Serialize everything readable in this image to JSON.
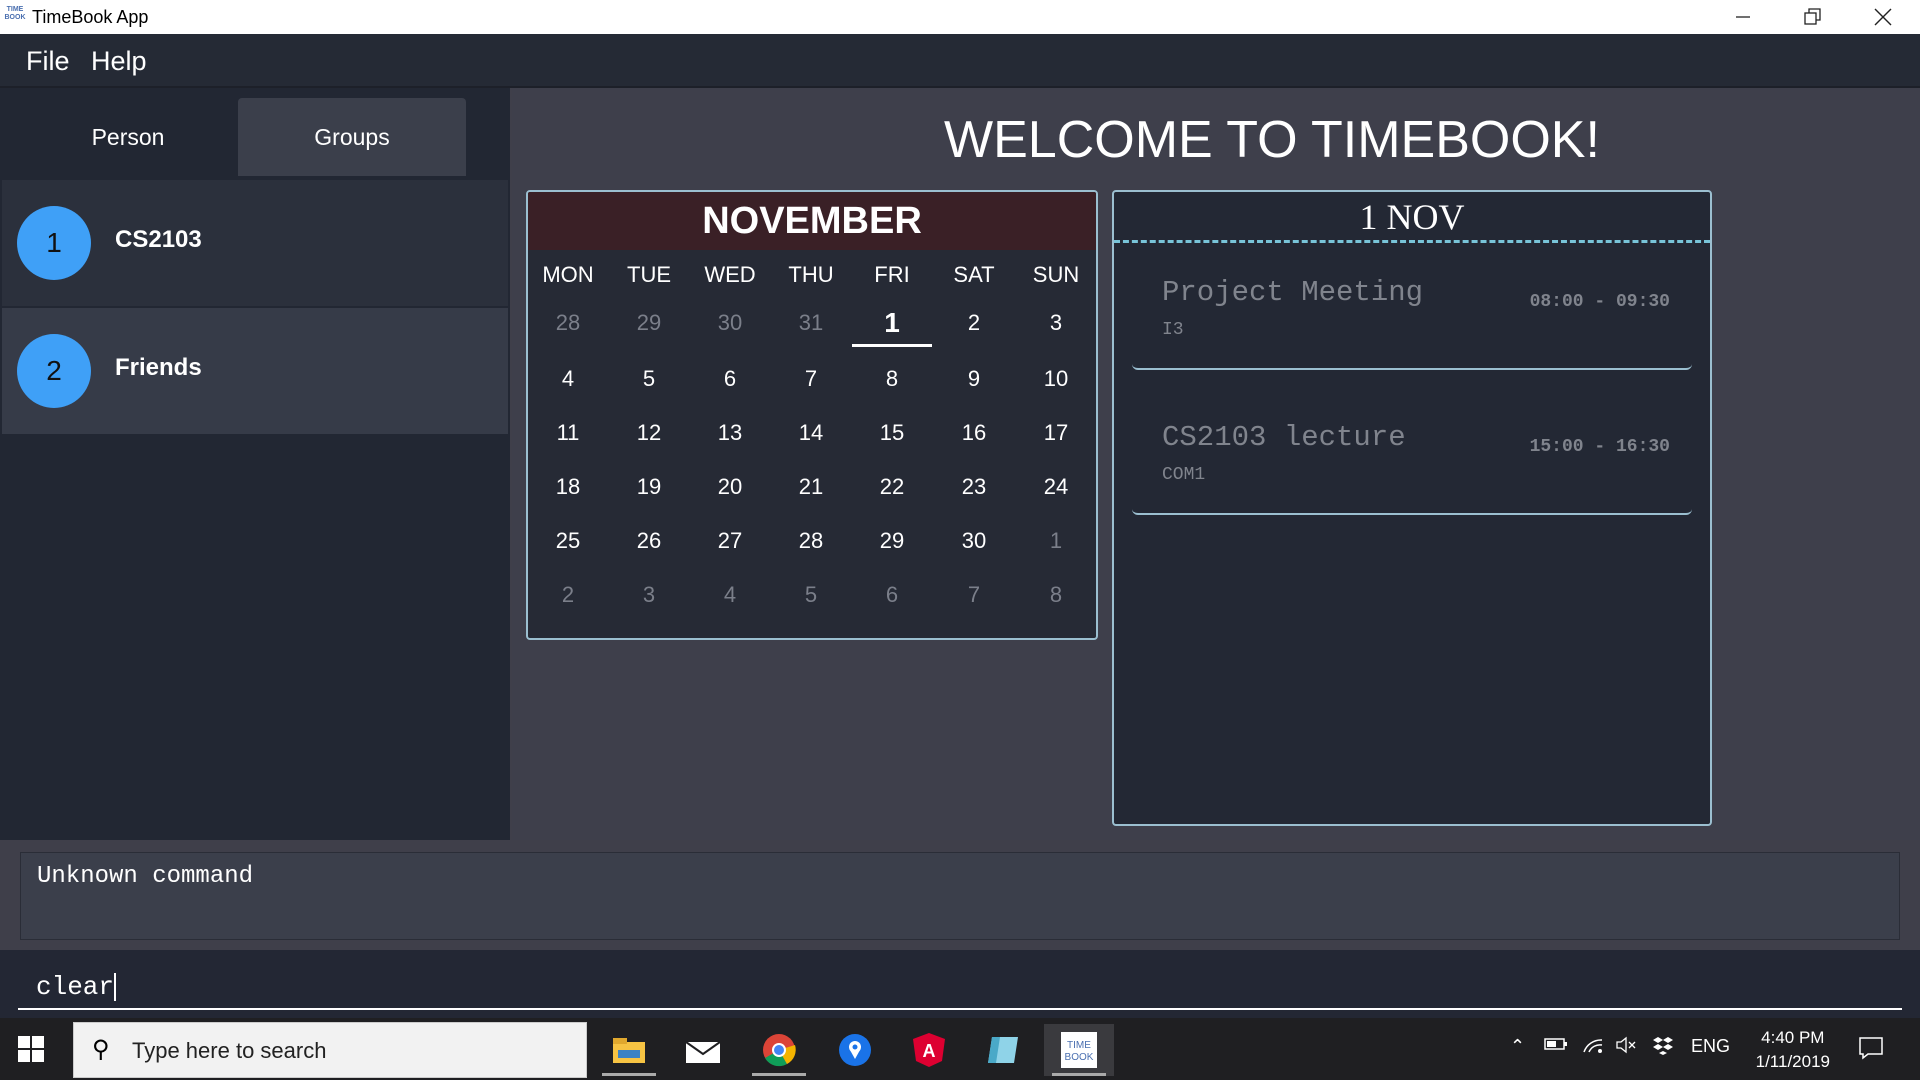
{
  "window": {
    "title": "TimeBook App",
    "icon_text": "TIME BOOK"
  },
  "menu": {
    "file": "File",
    "help": "Help"
  },
  "tabs": [
    {
      "label": "Person"
    },
    {
      "label": "Groups"
    }
  ],
  "groups": [
    {
      "index": "1",
      "name": "CS2103"
    },
    {
      "index": "2",
      "name": "Friends"
    }
  ],
  "welcome": "WELCOME TO TIMEBOOK!",
  "calendar": {
    "month": "NOVEMBER",
    "weekdays": [
      "MON",
      "TUE",
      "WED",
      "THU",
      "FRI",
      "SAT",
      "SUN"
    ],
    "weeks": [
      [
        "28",
        "29",
        "30",
        "31",
        "1",
        "2",
        "3"
      ],
      [
        "4",
        "5",
        "6",
        "7",
        "8",
        "9",
        "10"
      ],
      [
        "11",
        "12",
        "13",
        "14",
        "15",
        "16",
        "17"
      ],
      [
        "18",
        "19",
        "20",
        "21",
        "22",
        "23",
        "24"
      ],
      [
        "25",
        "26",
        "27",
        "28",
        "29",
        "30",
        "1"
      ],
      [
        "2",
        "3",
        "4",
        "5",
        "6",
        "7",
        "8"
      ]
    ],
    "selected": "1"
  },
  "schedule": {
    "date": "1 NOV",
    "events": [
      {
        "title": "Project Meeting",
        "location": "I3",
        "time": "08:00 - 09:30"
      },
      {
        "title": "CS2103 lecture",
        "location": "COM1",
        "time": "15:00 - 16:30"
      }
    ]
  },
  "result": "Unknown command",
  "command": "clear",
  "taskbar": {
    "search_placeholder": "Type here to search",
    "language": "ENG",
    "time": "4:40 PM",
    "date": "1/11/2019"
  },
  "colors": {
    "accent": "#3fa0f7",
    "calendar_header": "#3a2026",
    "border": "#9bbfd0"
  }
}
